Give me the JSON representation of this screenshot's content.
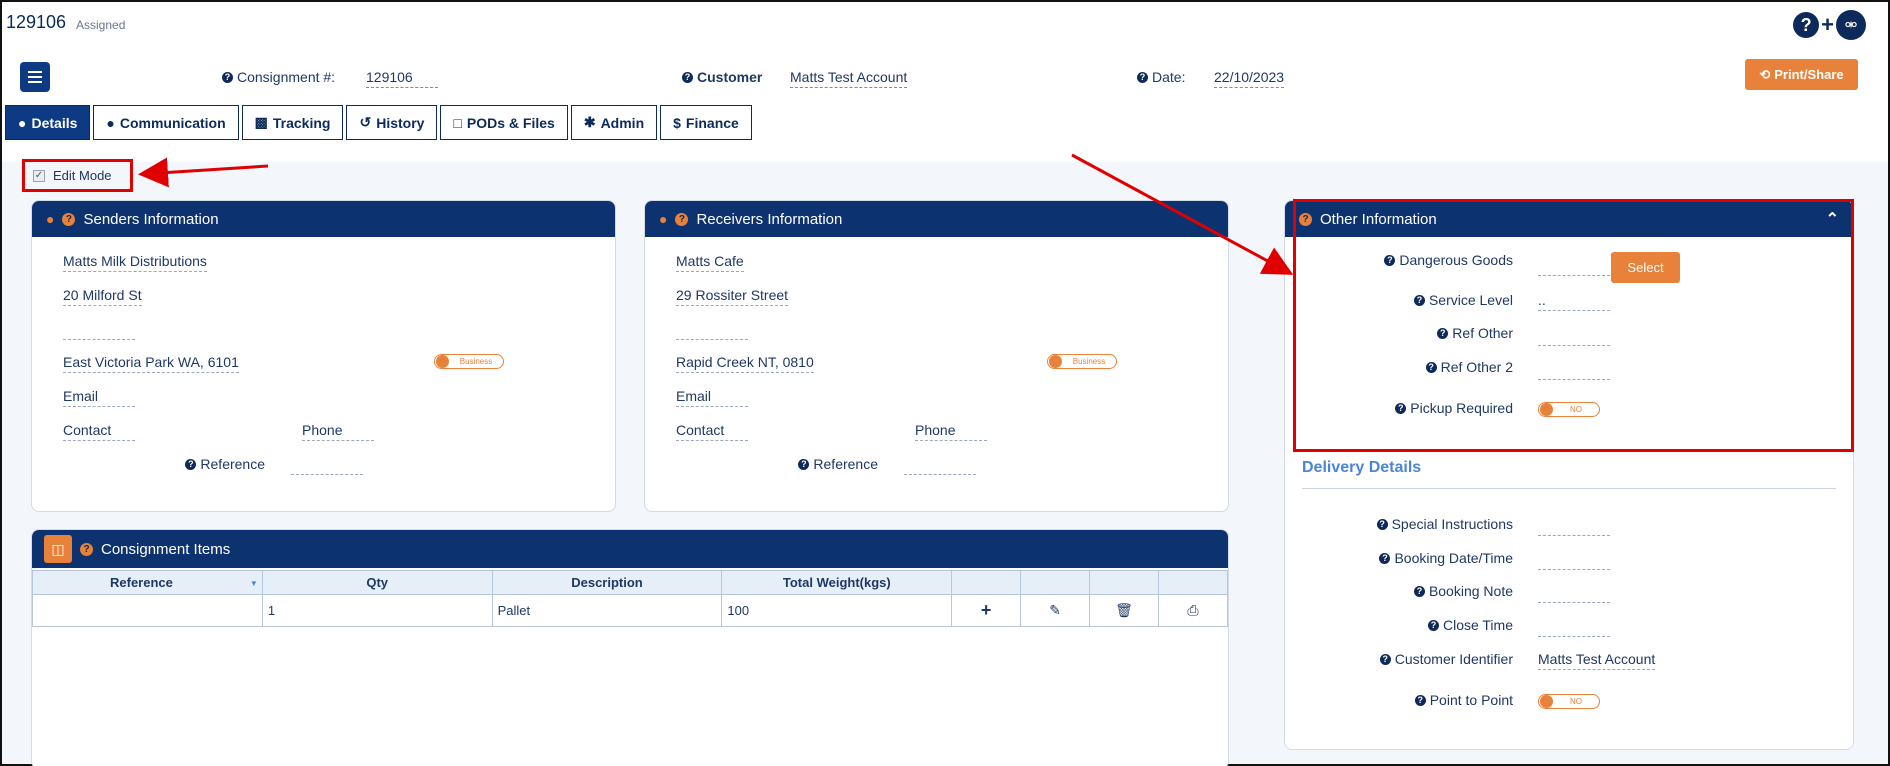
{
  "header": {
    "job_number": "129106",
    "status": "Assigned",
    "consignment_label": "Consignment #:",
    "consignment_value": "129106",
    "customer_label": "Customer",
    "customer_value": "Matts Test Account",
    "date_label": "Date:",
    "date_value": "22/10/2023",
    "print_label": "Print/Share"
  },
  "tabs": [
    {
      "label": "Details",
      "icon": "user-icon"
    },
    {
      "label": "Communication",
      "icon": "comment-icon"
    },
    {
      "label": "Tracking",
      "icon": "truck-icon"
    },
    {
      "label": "History",
      "icon": "history-icon"
    },
    {
      "label": "PODs & Files",
      "icon": "file-icon"
    },
    {
      "label": "Admin",
      "icon": "gear-icon"
    },
    {
      "label": "Finance",
      "icon": "dollar-icon"
    }
  ],
  "edit_mode": {
    "label": "Edit Mode",
    "checked": true
  },
  "senders": {
    "title": "Senders Information",
    "name": "Matts Milk Distributions",
    "address1": "20 Milford St",
    "address2": "",
    "suburb": "East Victoria Park WA, 6101",
    "toggle": "Business",
    "email": "Email",
    "contact": "Contact",
    "phone": "Phone",
    "reference_label": "Reference"
  },
  "receivers": {
    "title": "Receivers Information",
    "name": "Matts Cafe",
    "address1": "29 Rossiter Street",
    "address2": "",
    "suburb": "Rapid Creek NT, 0810",
    "toggle": "Business",
    "email": "Email",
    "contact": "Contact",
    "phone": "Phone",
    "reference_label": "Reference"
  },
  "other": {
    "title": "Other Information",
    "dangerous_goods": "Dangerous Goods",
    "select_label": "Select",
    "service_level": "Service Level",
    "service_level_value": "..",
    "ref_other": "Ref Other",
    "ref_other2": "Ref Other 2",
    "pickup_required": "Pickup Required",
    "pickup_toggle": "NO"
  },
  "delivery": {
    "title": "Delivery Details",
    "special_instructions": "Special Instructions",
    "booking_datetime": "Booking Date/Time",
    "booking_note": "Booking Note",
    "close_time": "Close Time",
    "customer_identifier": "Customer Identifier",
    "customer_identifier_value": "Matts Test Account",
    "point_to_point": "Point to Point",
    "point_toggle": "NO"
  },
  "items": {
    "title": "Consignment Items",
    "columns": [
      "Reference",
      "Qty",
      "Description",
      "Total Weight(kgs)"
    ],
    "rows": [
      {
        "reference": "",
        "qty": "1",
        "description": "Pallet",
        "weight": "100"
      }
    ]
  },
  "colors": {
    "navy": "#0d3270",
    "orange": "#e8813a",
    "highlight": "#e00000",
    "accent_blue": "#4a86d8"
  }
}
